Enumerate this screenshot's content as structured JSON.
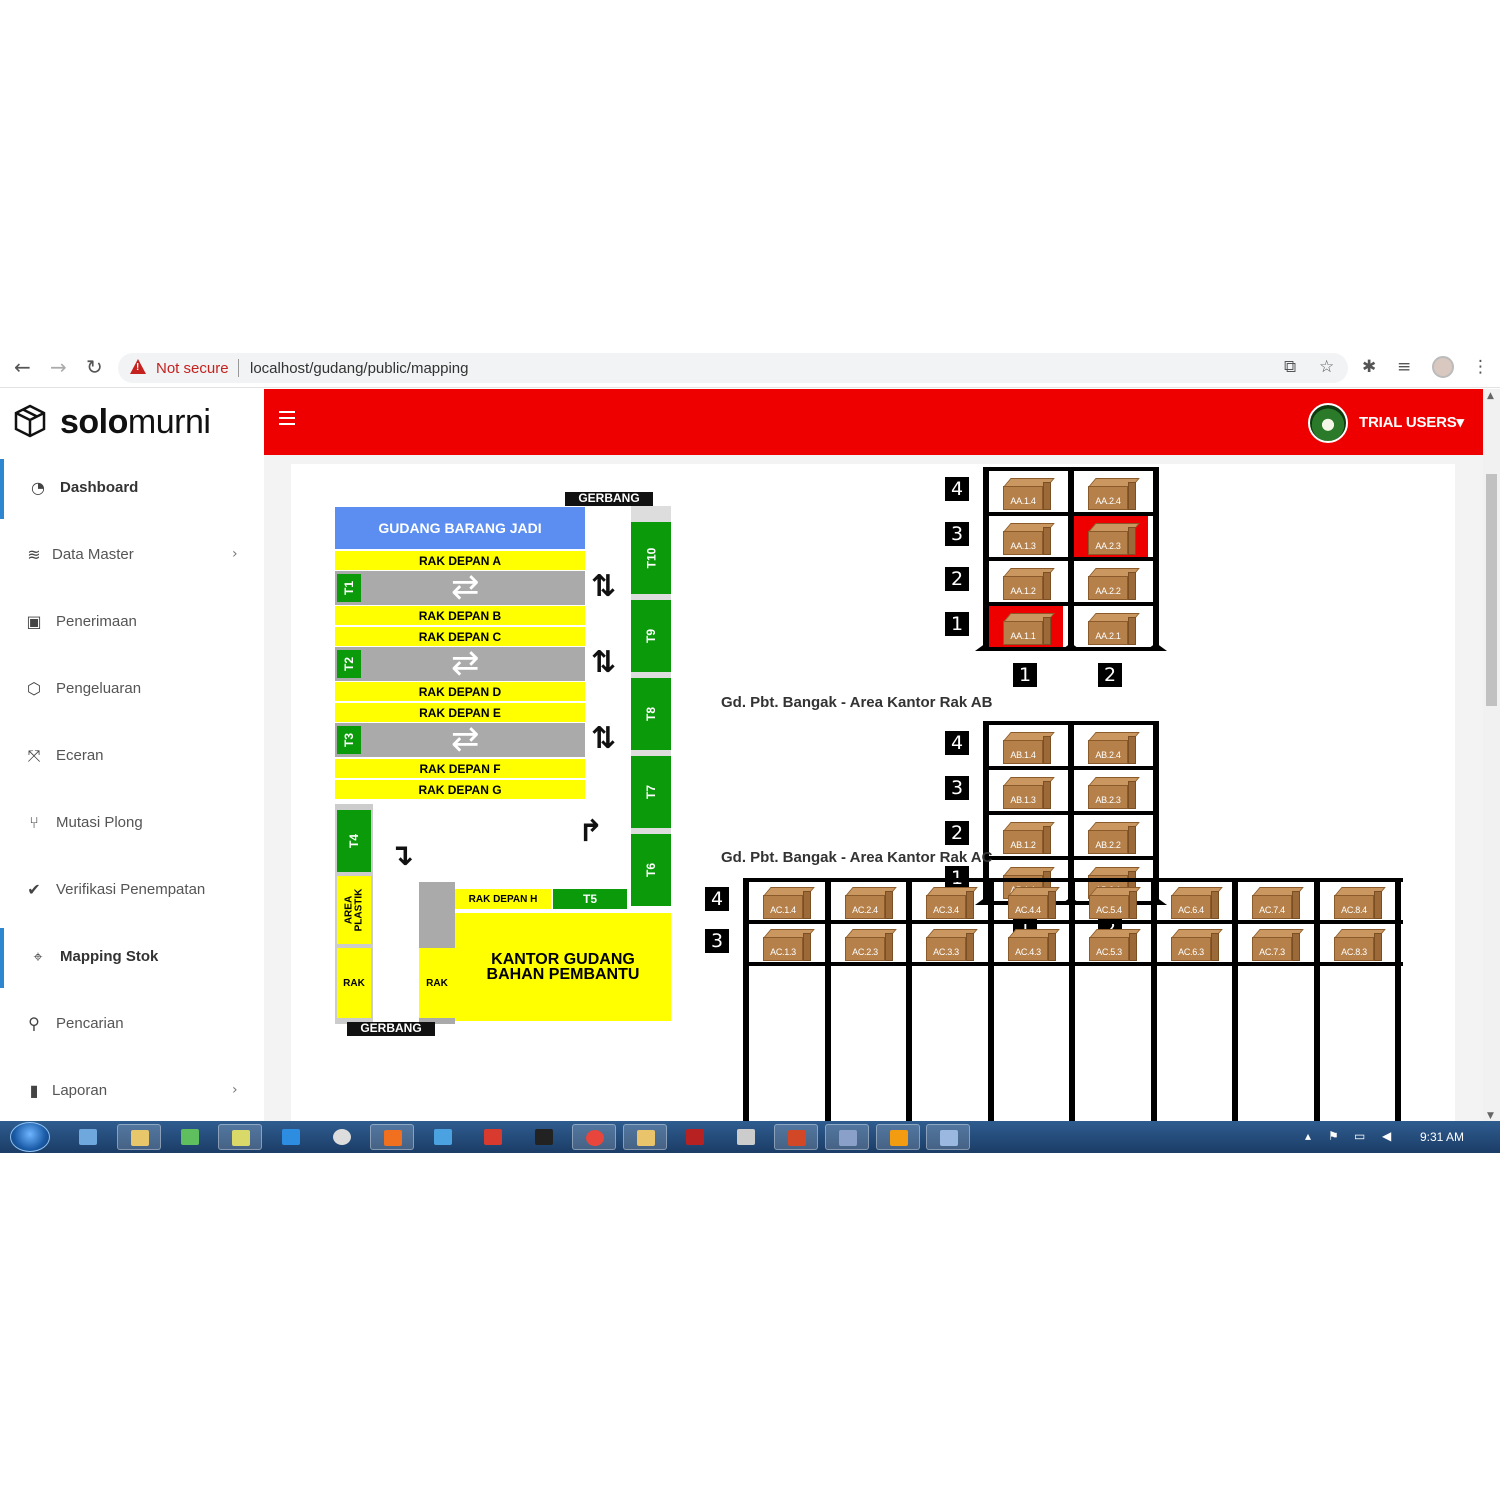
{
  "browser": {
    "security_text": "Not secure",
    "url": "localhost/gudang/public/mapping"
  },
  "app": {
    "logo_bold": "solo",
    "logo_regular": "murni",
    "user_name": "TRIAL USERS",
    "user_caret": "▾"
  },
  "sidebar": {
    "items": [
      {
        "label": "Dashboard",
        "icon": "dashboard-icon",
        "active": true
      },
      {
        "label": "Data Master",
        "icon": "database-icon",
        "submenu": true
      },
      {
        "label": "Penerimaan",
        "icon": "inbox-download-icon"
      },
      {
        "label": "Pengeluaran",
        "icon": "shipping-out-icon"
      },
      {
        "label": "Eceran",
        "icon": "expand-icon"
      },
      {
        "label": "Mutasi Plong",
        "icon": "merge-icon"
      },
      {
        "label": "Verifikasi Penempatan",
        "icon": "check-circle-icon"
      },
      {
        "label": "Mapping Stok",
        "icon": "map-pin-icon",
        "active": true
      },
      {
        "label": "Pencarian",
        "icon": "search-icon"
      },
      {
        "label": "Laporan",
        "icon": "chart-icon",
        "submenu": true
      }
    ],
    "chevron": "›"
  },
  "map": {
    "gate_top": "GERBANG",
    "gate_bottom": "GERBANG",
    "gudang_barang_jadi": "GUDANG BARANG JADI",
    "rak_depan_a": "RAK DEPAN A",
    "rak_depan_b": "RAK DEPAN B",
    "rak_depan_c": "RAK DEPAN C",
    "rak_depan_d": "RAK DEPAN D",
    "rak_depan_e": "RAK DEPAN E",
    "rak_depan_f": "RAK DEPAN F",
    "rak_depan_g": "RAK DEPAN G",
    "rak_depan_h": "RAK DEPAN H",
    "t1": "T1",
    "t2": "T2",
    "t3": "T3",
    "t4": "T4",
    "t5": "T5",
    "t6": "T6",
    "t7": "T7",
    "t8": "T8",
    "t9": "T9",
    "t10": "T10",
    "area_plastik_1": "AREA",
    "area_plastik_2": "PLASTIK",
    "rak_small_1": "RAK",
    "rak_small_2": "RAK",
    "kantor_1": "KANTOR GUDANG",
    "kantor_2": "BAHAN PEMBANTU"
  },
  "racks": [
    {
      "title": "Gd. Pbt. Bangak - Area Kantor Rak AA",
      "rows": [
        "4",
        "3",
        "2",
        "1"
      ],
      "cols": [
        "1",
        "2"
      ],
      "cells": [
        [
          "AA.1.4",
          "AA.2.4"
        ],
        [
          "AA.1.3",
          "AA.2.3"
        ],
        [
          "AA.1.2",
          "AA.2.2"
        ],
        [
          "AA.1.1",
          "AA.2.1"
        ]
      ],
      "highlighted": [
        "AA.2.3",
        "AA.1.1"
      ],
      "highlight_color": "#ee0000"
    },
    {
      "title": "Gd. Pbt. Bangak - Area Kantor Rak AB",
      "rows": [
        "4",
        "3",
        "2",
        "1"
      ],
      "cols": [
        "1",
        "2"
      ],
      "cells": [
        [
          "AB.1.4",
          "AB.2.4"
        ],
        [
          "AB.1.3",
          "AB.2.3"
        ],
        [
          "AB.1.2",
          "AB.2.2"
        ],
        [
          "AB.1.1",
          "AB.2.1"
        ]
      ],
      "highlighted": []
    },
    {
      "title": "Gd. Pbt. Bangak - Area Kantor Rak AC",
      "rows": [
        "4",
        "3"
      ],
      "cells": [
        [
          "AC.1.4",
          "AC.2.4",
          "AC.3.4",
          "AC.4.4",
          "AC.5.4",
          "AC.6.4",
          "AC.7.4",
          "AC.8.4"
        ],
        [
          "AC.1.3",
          "AC.2.3",
          "AC.3.3",
          "AC.4.3",
          "AC.5.3",
          "AC.6.3",
          "AC.7.3",
          "AC.8.3"
        ]
      ],
      "highlighted": []
    }
  ],
  "taskbar": {
    "clock": "9:31 AM"
  },
  "colors": {
    "topbar": "#ee0000",
    "active_border": "#2f86d0",
    "map_yellow": "#ffff00",
    "map_green": "#0a9a0a",
    "map_blue": "#5b8ef0",
    "map_gray": "#aaaaaa"
  }
}
